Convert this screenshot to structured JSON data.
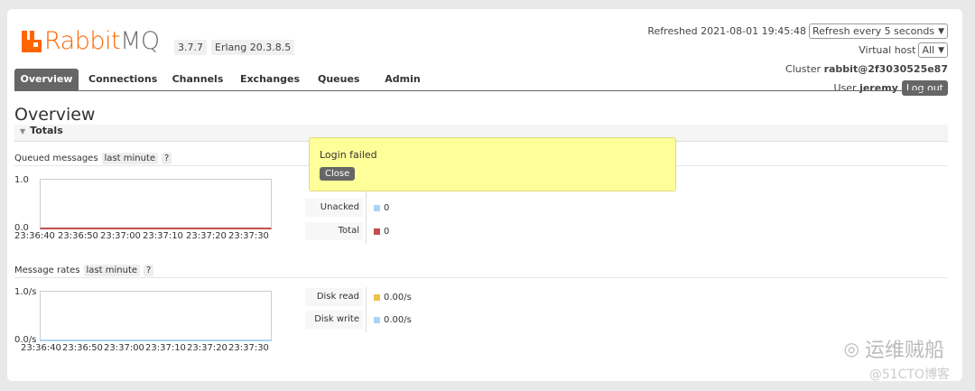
{
  "brand": {
    "rabbit": "Rabbit",
    "mq": "MQ"
  },
  "versions": {
    "rabbitmq": "3.7.7",
    "erlang": "Erlang 20.3.8.5"
  },
  "header": {
    "refreshed": "Refreshed 2021-08-01 19:45:48",
    "refresh_select": "Refresh every 5 seconds",
    "vhost_label": "Virtual host",
    "vhost_select": "All",
    "cluster_label": "Cluster",
    "cluster_name": "rabbit@2f3030525e87",
    "user_label": "User",
    "user_name": "jeremy",
    "logout": "Log out"
  },
  "tabs": [
    "Overview",
    "Connections",
    "Channels",
    "Exchanges",
    "Queues",
    "Admin"
  ],
  "page_title": "Overview",
  "totals_section": "Totals",
  "queued": {
    "label": "Queued messages",
    "range": "last minute",
    "help": "?",
    "y_top": "1.0",
    "y_bottom": "0.0",
    "x_ticks": [
      "23:36:40",
      "23:36:50",
      "23:37:00",
      "23:37:10",
      "23:37:20",
      "23:37:30"
    ],
    "legend": [
      {
        "label": "Unacked",
        "value": "0",
        "color": "#aad4f5"
      },
      {
        "label": "Total",
        "value": "0",
        "color": "#c0504d"
      }
    ]
  },
  "rates": {
    "label": "Message rates",
    "range": "last minute",
    "help": "?",
    "y_top": "1.0/s",
    "y_bottom": "0.0/s",
    "x_ticks": [
      "23:36:40",
      "23:36:50",
      "23:37:00",
      "23:37:10",
      "23:37:20",
      "23:37:30"
    ],
    "legend": [
      {
        "label": "Disk read",
        "value": "0.00/s",
        "color": "#f0c24b"
      },
      {
        "label": "Disk write",
        "value": "0.00/s",
        "color": "#aad4f5"
      }
    ]
  },
  "popup": {
    "message": "Login failed",
    "close": "Close"
  },
  "watermark": {
    "main": "运维贼船",
    "sub": "@51CTO博客"
  }
}
